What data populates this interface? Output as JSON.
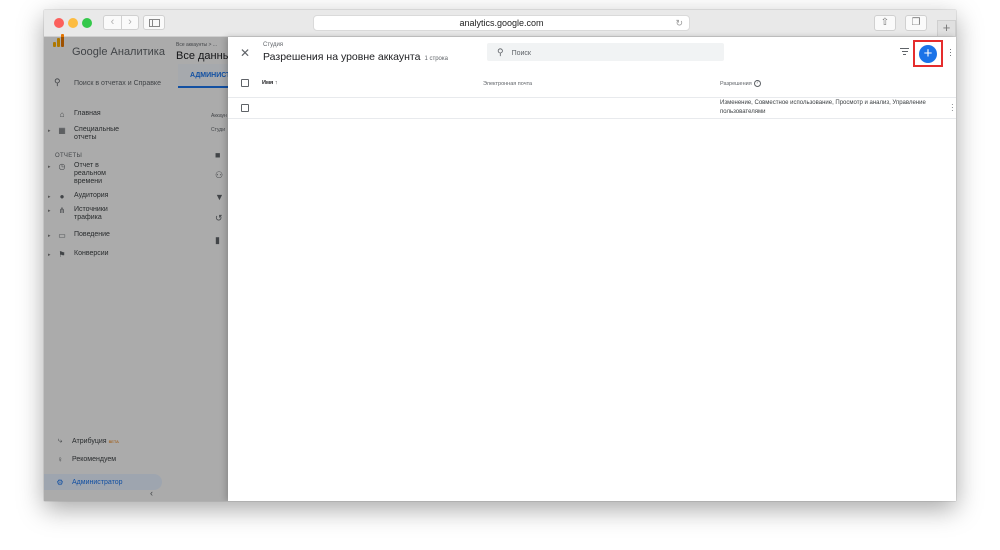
{
  "browser": {
    "url": "analytics.google.com",
    "back": "‹",
    "forward": "›",
    "new_tab": "+"
  },
  "sidebar": {
    "app_title": "Google Аналитика",
    "search_label": "Поиск в отчетах и Справке",
    "items": [
      {
        "label": "Главная",
        "icon": "home-icon"
      },
      {
        "label": "Специальные отчеты",
        "icon": "dashboard-icon"
      },
      {
        "label": "Отчет в реальном времени",
        "icon": "clock-icon"
      },
      {
        "label": "Аудитория",
        "icon": "person-icon"
      },
      {
        "label": "Источники трафика",
        "icon": "acquisition-icon"
      },
      {
        "label": "Поведение",
        "icon": "behavior-icon"
      },
      {
        "label": "Конверсии",
        "icon": "flag-icon"
      }
    ],
    "section_reports": "ОТЧЕТЫ",
    "bottom": [
      {
        "label": "Атрибуция",
        "badge": "BETA",
        "icon": "attribution-icon"
      },
      {
        "label": "Рекомендуем",
        "icon": "lightbulb-icon"
      },
      {
        "label": "Администратор",
        "icon": "gear-icon"
      }
    ]
  },
  "background": {
    "breadcrumb": "Все аккаунты > ...",
    "account_name": "Все данны",
    "admin_tab": "АДМИНИСТРАТОР",
    "mid_label_1": "Аккаун",
    "mid_label_2": "Студи"
  },
  "panel": {
    "subtitle": "Студия",
    "title": "Разрешения на уровне аккаунта",
    "count": "1 строка",
    "search_placeholder": "Поиск",
    "columns": {
      "name": "Имя",
      "email": "Электронная почта",
      "permissions": "Разрешения"
    },
    "rows": [
      {
        "name": "",
        "email": "",
        "permissions": "Изменение, Совместное использование, Просмотр и анализ, Управление пользователями"
      }
    ],
    "accent_color": "#1a73e8",
    "highlight_color": "#e52d2d"
  }
}
